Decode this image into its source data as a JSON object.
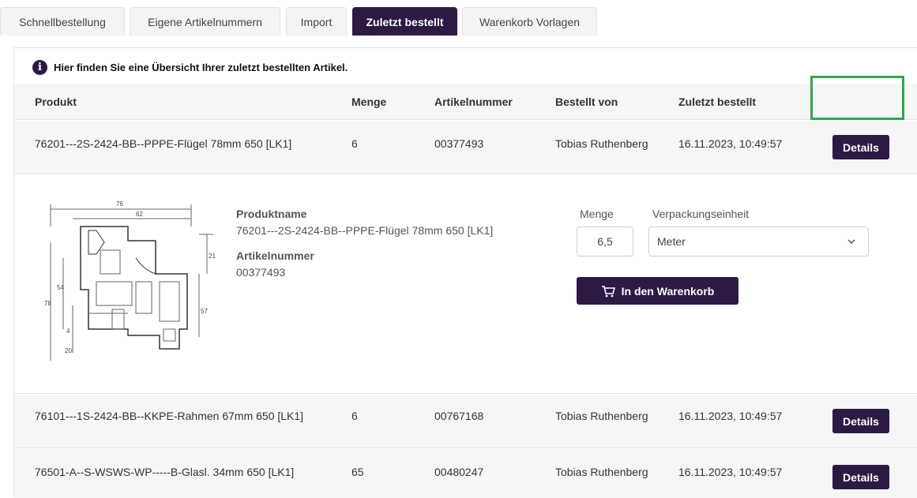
{
  "tabs": [
    {
      "label": "Schnellbestellung"
    },
    {
      "label": "Eigene Artikelnummern"
    },
    {
      "label": "Import"
    },
    {
      "label": "Zuletzt bestellt"
    },
    {
      "label": "Warenkorb Vorlagen"
    }
  ],
  "info_text": "Hier finden Sie eine Übersicht Ihrer zuletzt bestellten Artikel.",
  "columns": {
    "product": "Produkt",
    "quantity": "Menge",
    "article_number": "Artikelnummer",
    "ordered_by": "Bestellt von",
    "last_ordered": "Zuletzt bestellt"
  },
  "rows": [
    {
      "product": "76201---2S-2424-BB--PPPE-Flügel 78mm 650 [LK1]",
      "quantity": "6",
      "article_number": "00377493",
      "ordered_by": "Tobias Ruthenberg",
      "last_ordered": "16.11.2023, 10:49:57",
      "button": "Details"
    },
    {
      "product": "76101---1S-2424-BB--KKPE-Rahmen 67mm 650 [LK1]",
      "quantity": "6",
      "article_number": "00767168",
      "ordered_by": "Tobias Ruthenberg",
      "last_ordered": "16.11.2023, 10:49:57",
      "button": "Details"
    },
    {
      "product": "76501-A--S-WSWS-WP-----B-Glasl. 34mm 650 [LK1]",
      "quantity": "65",
      "article_number": "00480247",
      "ordered_by": "Tobias Ruthenberg",
      "last_ordered": "16.11.2023, 10:49:57",
      "button": "Details"
    }
  ],
  "detail": {
    "product_name_label": "Produktname",
    "product_name": "76201---2S-2424-BB--PPPE-Flügel 78mm 650 [LK1]",
    "article_number_label": "Artikelnummer",
    "article_number": "00377493",
    "quantity_label": "Menge",
    "quantity_value": "6,5",
    "unit_label": "Verpackungseinheit",
    "unit_value": "Meter",
    "cart_button": "In den Warenkorb",
    "drawing_dimensions": [
      "76",
      "62",
      "21",
      "54",
      "78",
      "57",
      "4",
      "20"
    ]
  },
  "icons": {
    "info": "info-icon",
    "chevron": "chevron-down-icon",
    "cart": "cart-icon"
  },
  "colors": {
    "accent": "#2c1a45",
    "highlight": "#2fa84f",
    "row_bg": "#f6f6f6"
  }
}
